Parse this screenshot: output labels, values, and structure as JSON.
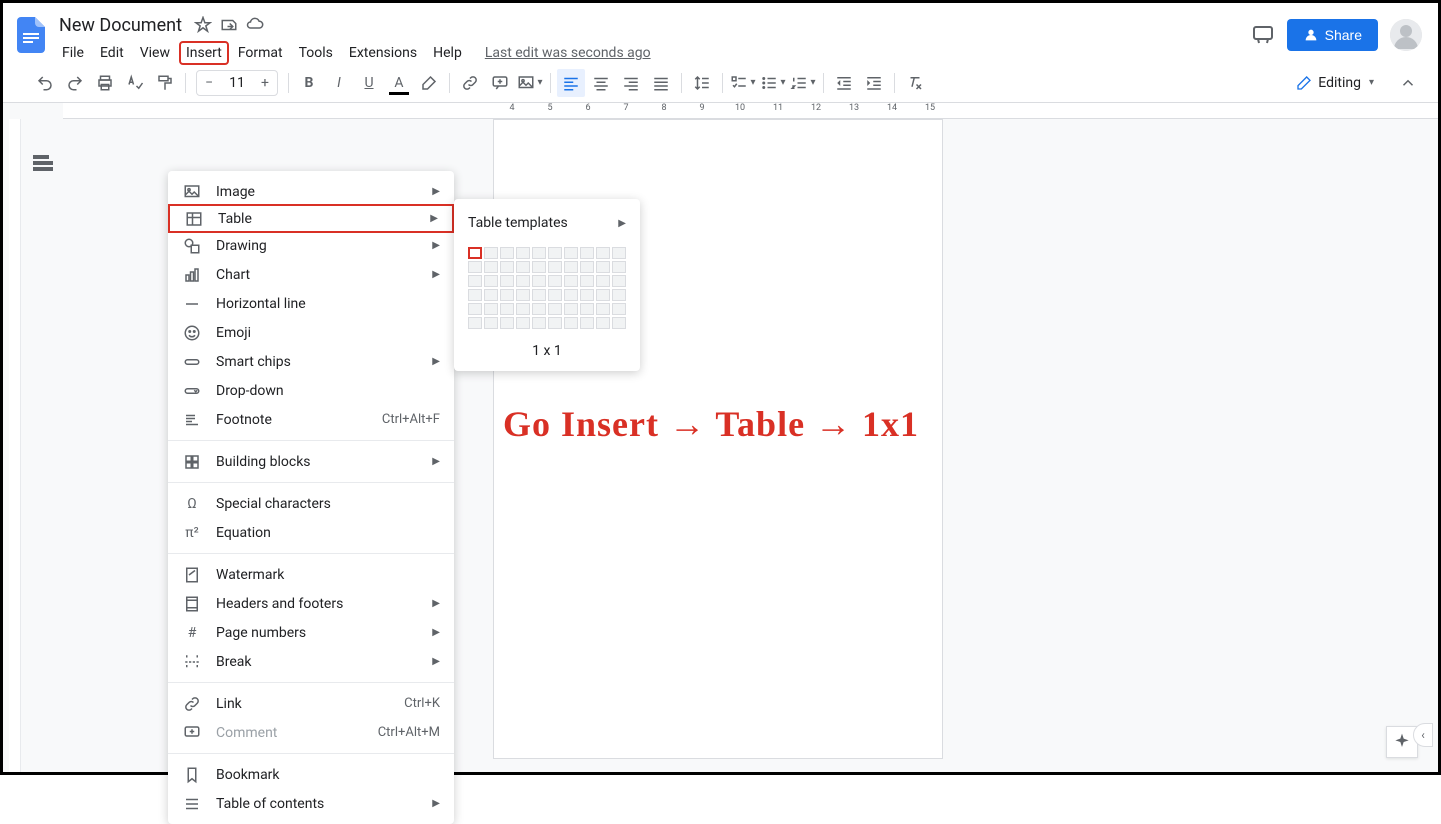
{
  "doc_title": "New Document",
  "last_edit": "Last edit was seconds ago",
  "menus": [
    "File",
    "Edit",
    "View",
    "Insert",
    "Format",
    "Tools",
    "Extensions",
    "Help"
  ],
  "share_label": "Share",
  "font_size": "11",
  "editing_mode": "Editing",
  "insert_menu": {
    "image": "Image",
    "table": "Table",
    "drawing": "Drawing",
    "chart": "Chart",
    "hline": "Horizontal line",
    "emoji": "Emoji",
    "smartchips": "Smart chips",
    "dropdown": "Drop-down",
    "footnote": "Footnote",
    "footnote_sc": "Ctrl+Alt+F",
    "building_blocks": "Building blocks",
    "special_chars": "Special characters",
    "equation": "Equation",
    "watermark": "Watermark",
    "headers_footers": "Headers and footers",
    "page_numbers": "Page numbers",
    "break": "Break",
    "link": "Link",
    "link_sc": "Ctrl+K",
    "comment": "Comment",
    "comment_sc": "Ctrl+Alt+M",
    "bookmark": "Bookmark",
    "toc": "Table of contents"
  },
  "table_submenu": {
    "templates": "Table templates",
    "size": "1 x 1"
  },
  "ruler_ticks": [
    "4",
    "5",
    "6",
    "7",
    "8",
    "9",
    "10",
    "11",
    "12",
    "13",
    "14",
    "15"
  ],
  "annotation_text": "Go Insert → Table → 1x1"
}
